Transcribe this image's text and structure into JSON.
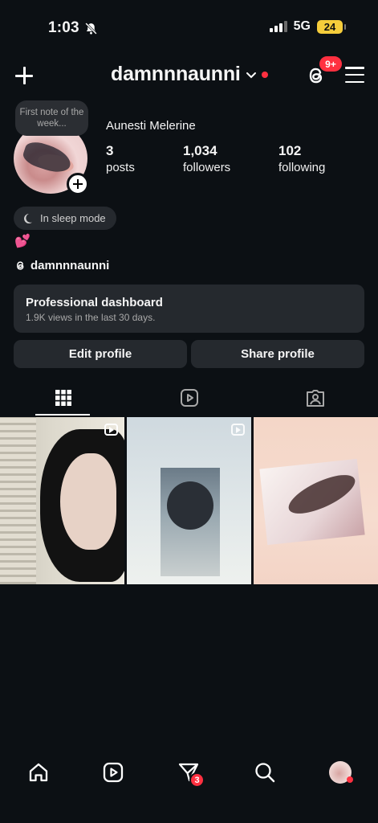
{
  "status_bar": {
    "time": "1:03",
    "network": "5G",
    "battery": "24",
    "mute_icon": "bell-slash-icon"
  },
  "header": {
    "username": "damnnnaunni",
    "notifications_badge": "9+",
    "icons": [
      "plus-icon",
      "chevron-down-icon",
      "threads-icon",
      "menu-icon"
    ]
  },
  "profile": {
    "note": "First note of the week...",
    "full_name": "Aunesti Melerine",
    "stats": [
      {
        "value": "3",
        "label": "posts"
      },
      {
        "value": "1,034",
        "label": "followers"
      },
      {
        "value": "102",
        "label": "following"
      }
    ],
    "status_pill": "In sleep mode",
    "bio_emoji": "💕",
    "threads_handle": "damnnnaunni"
  },
  "professional_dashboard": {
    "title": "Professional dashboard",
    "subtitle": "1.9K views in the last 30 days."
  },
  "actions": {
    "edit_profile": "Edit profile",
    "share_profile": "Share profile"
  },
  "tabs": [
    {
      "name": "grid",
      "icon": "grid-icon",
      "active": true
    },
    {
      "name": "reels",
      "icon": "reels-icon",
      "active": false
    },
    {
      "name": "tagged",
      "icon": "tagged-icon",
      "active": false
    }
  ],
  "posts": [
    {
      "type": "reel"
    },
    {
      "type": "reel"
    },
    {
      "type": "photo"
    }
  ],
  "bottom_nav": {
    "items": [
      "home-icon",
      "reels-icon",
      "messages-icon",
      "search-icon",
      "profile-avatar"
    ],
    "messages_badge": "3"
  },
  "colors": {
    "background": "#0c1014",
    "surface": "#25292e",
    "badge_red": "#ff3040",
    "battery": "#f6cd3b"
  }
}
